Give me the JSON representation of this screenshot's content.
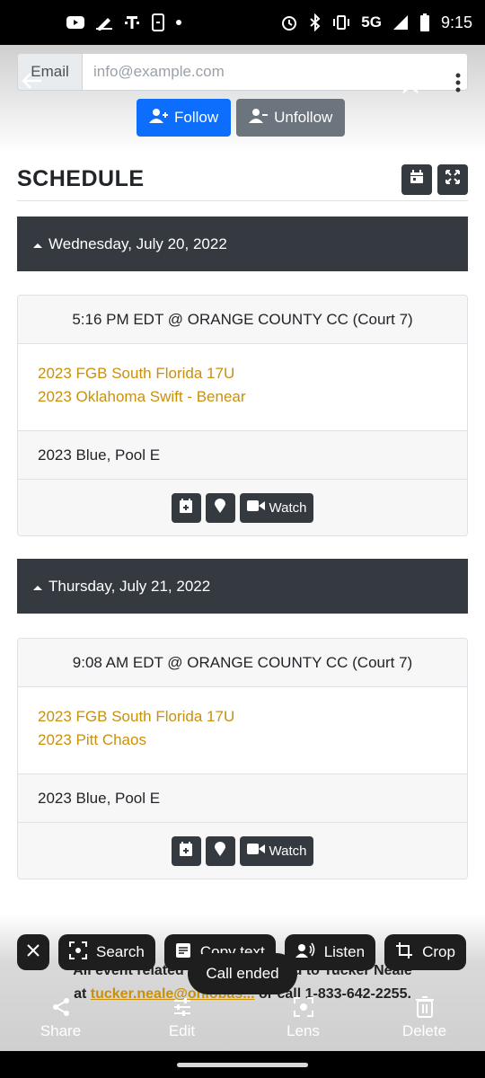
{
  "status_bar": {
    "time": "9:15",
    "network": "5G"
  },
  "email": {
    "label": "Email",
    "placeholder": "info@example.com"
  },
  "follow_buttons": {
    "follow": "Follow",
    "unfollow": "Unfollow"
  },
  "schedule": {
    "title": "SCHEDULE",
    "days": [
      {
        "label": "Wednesday, July 20, 2022",
        "game": {
          "time_location": "5:16 PM EDT @ ORANGE COUNTY CC (Court 7)",
          "team1": "2023 FGB South Florida 17U",
          "team2": "2023 Oklahoma Swift - Benear",
          "pool": "2023 Blue, Pool E",
          "watch_label": "Watch"
        }
      },
      {
        "label": "Thursday, July 21, 2022",
        "game": {
          "time_location": "9:08 AM EDT @ ORANGE COUNTY CC (Court 7)",
          "team1": "2023 FGB South Florida 17U",
          "team2": "2023 Pitt Chaos",
          "pool": "2023 Blue, Pool E",
          "watch_label": "Watch"
        }
      }
    ]
  },
  "footer": {
    "line1": "All event related questi... directed to Tucker Neale",
    "line2_prefix": "at",
    "email_link": "tucker.neale@ohiobas...",
    "line2_suffix": "or call 1-833-642-2255."
  },
  "chips": {
    "search": "Search",
    "copy_text": "Copy text",
    "listen": "Listen",
    "crop": "Crop"
  },
  "toast": "Call ended",
  "actions": {
    "share": "Share",
    "edit": "Edit",
    "lens": "Lens",
    "delete": "Delete"
  },
  "colors": {
    "accent": "#0d6efd",
    "team_link": "#c9900a",
    "dark_bar": "#343a40"
  }
}
